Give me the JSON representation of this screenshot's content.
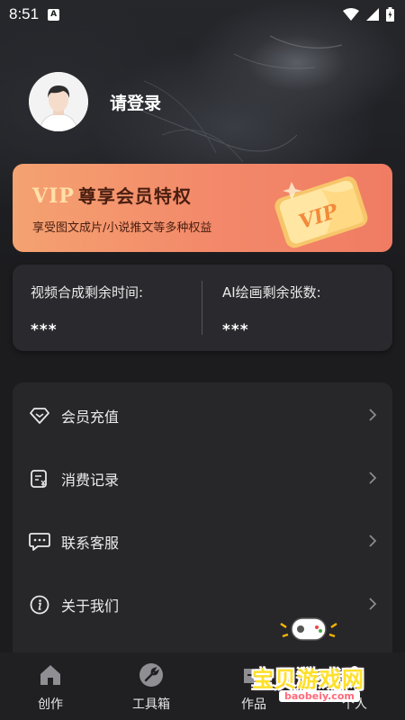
{
  "status_bar": {
    "time": "8:51",
    "badge": "A"
  },
  "profile": {
    "login_label": "请登录"
  },
  "vip": {
    "vip_word": "VIP",
    "title": "尊享会员特权",
    "subtitle": "享受图文成片/小说推文等多种权益",
    "card_text": "VIP"
  },
  "stats": {
    "video": {
      "label": "视频合成剩余时间:",
      "value": "***"
    },
    "ai": {
      "label": "AI绘画剩余张数:",
      "value": "***"
    }
  },
  "menu": {
    "items": [
      {
        "label": "会员充值",
        "icon": "diamond-icon"
      },
      {
        "label": "消费记录",
        "icon": "receipt-icon"
      },
      {
        "label": "联系客服",
        "icon": "chat-icon"
      },
      {
        "label": "关于我们",
        "icon": "info-icon"
      }
    ]
  },
  "bottom_nav": {
    "items": [
      {
        "label": "创作",
        "icon": "home-icon"
      },
      {
        "label": "工具箱",
        "icon": "wrench-icon"
      },
      {
        "label": "作品",
        "icon": "folder-icon"
      },
      {
        "label": "个人",
        "icon": "person-icon"
      }
    ]
  },
  "watermark": {
    "text": "宝贝游戏网",
    "domain": "baobeiy.com"
  },
  "colors": {
    "background": "#1c1c1f",
    "card": "#2a2a2e",
    "vip_gradient_start": "#f4a271",
    "vip_gradient_end": "#f07c63",
    "vip_text": "#4a1e10",
    "vip_word": "#ffe0a8"
  }
}
